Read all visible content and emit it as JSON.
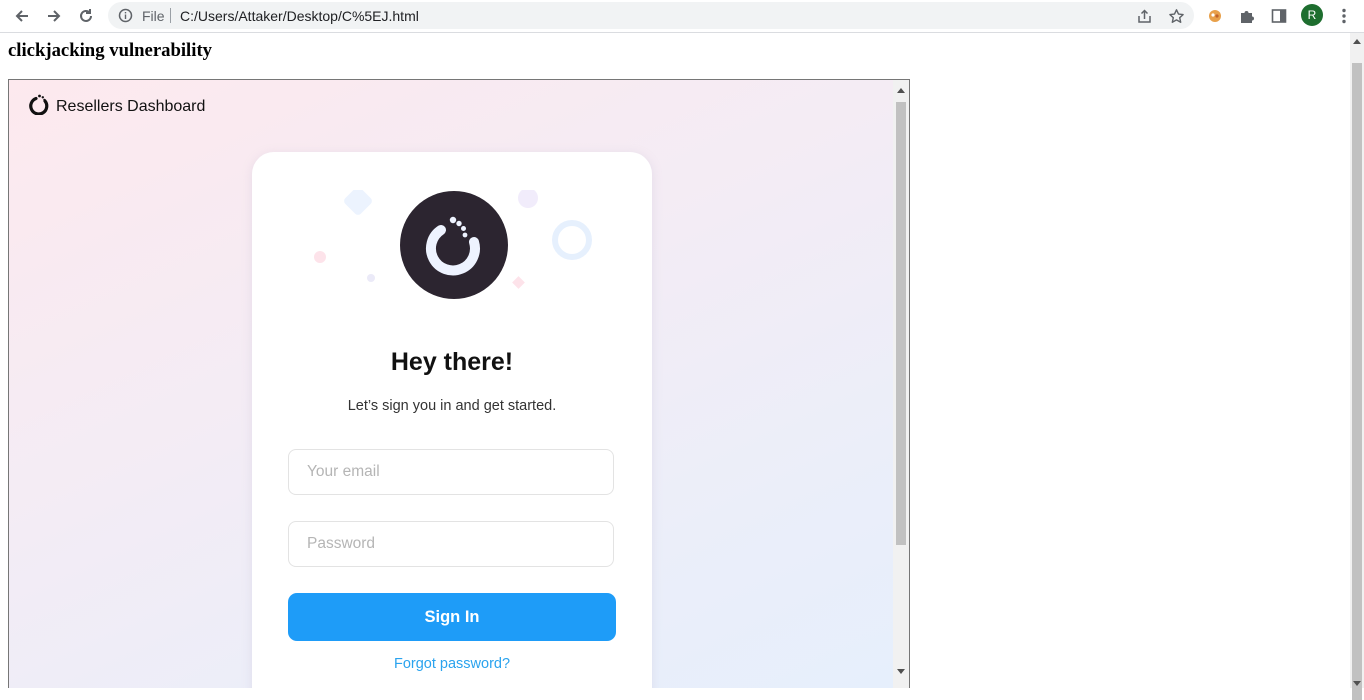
{
  "browser": {
    "file_label": "File",
    "url": "C:/Users/Attaker/Desktop/C%5EJ.html",
    "avatar_letter": "R",
    "icons": [
      "back-icon",
      "forward-icon",
      "reload-icon",
      "info-icon",
      "share-icon",
      "star-icon",
      "extension-icon",
      "puzzle-icon",
      "side-panel-icon",
      "menu-icon"
    ]
  },
  "page": {
    "heading": "clickjacking vulnerability"
  },
  "frame": {
    "brand_name": "Resellers Dashboard",
    "card": {
      "title": "Hey there!",
      "subtitle": "Let’s sign you in and get started.",
      "email_placeholder": "Your email",
      "password_placeholder": "Password",
      "signin_label": "Sign In",
      "forgot_label": "Forgot password?"
    }
  },
  "colors": {
    "primary": "#1e9cf8",
    "link": "#2aa3ee",
    "avatar": "#1e6e2f",
    "logo_dark": "#2c2530"
  }
}
